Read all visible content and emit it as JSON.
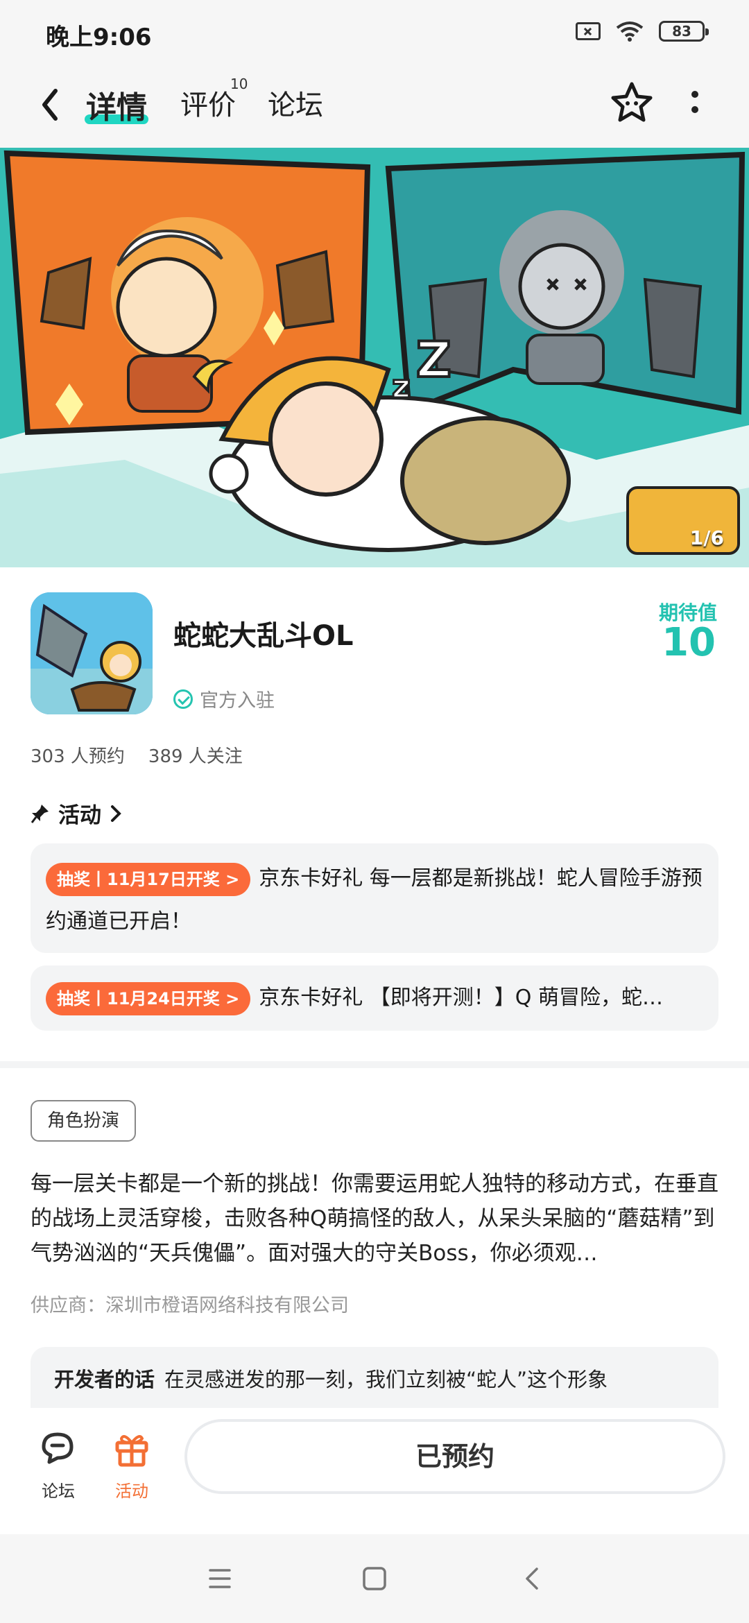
{
  "status_bar": {
    "time": "晚上9:06",
    "battery": "83"
  },
  "nav": {
    "tabs": [
      {
        "label": "详情",
        "active": true
      },
      {
        "label": "评价",
        "badge": "10"
      },
      {
        "label": "论坛"
      }
    ]
  },
  "banner": {
    "counter": "1/6"
  },
  "app": {
    "name": "蛇蛇大乱斗OL",
    "official": "官方入驻",
    "expect_label": "期待值",
    "expect_value": "10",
    "reservations": "303 人预约",
    "followers": "389 人关注"
  },
  "activity": {
    "title": "活动",
    "items": [
      {
        "badge": "抽奖丨11月17日开奖 >",
        "text": "京东卡好礼 每一层都是新挑战！蛇人冒险手游预约通道已开启！"
      },
      {
        "badge": "抽奖丨11月24日开奖 >",
        "text": "京东卡好礼 【即将开测！】Q 萌冒险，蛇…"
      }
    ]
  },
  "details": {
    "tag": "角色扮演",
    "description": "每一层关卡都是一个新的挑战！你需要运用蛇人独特的移动方式，在垂直的战场上灵活穿梭，击败各种Q萌搞怪的敌人，从呆头呆脑的“蘑菇精”到气势汹汹的“天兵傀儡”。面对强大的守关Boss，你必须观…",
    "supplier": "供应商：深圳市橙语网络科技有限公司",
    "dev_label": "开发者的话",
    "dev_text": "在灵感迸发的那一刻，我们立刻被“蛇人”这个形象"
  },
  "bottom_bar": {
    "forum_label": "论坛",
    "activity_label": "活动",
    "reserve_label": "已预约"
  },
  "colors": {
    "accent_teal": "#20d6c2",
    "accent_orange": "#fb6a3a"
  }
}
